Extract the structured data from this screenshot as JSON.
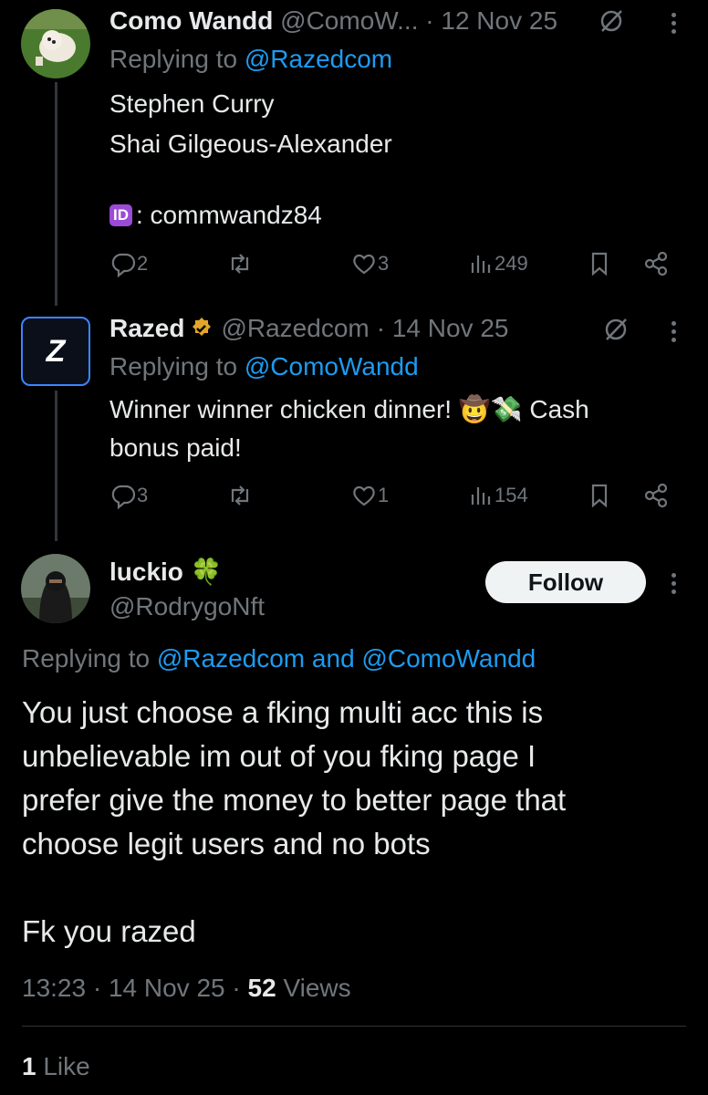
{
  "tweet1": {
    "name": "Como Wandd",
    "handle": "@ComoW...",
    "date": "· 12 Nov 25",
    "replying_prefix": "Replying to ",
    "replying_to": "@Razedcom",
    "lines": [
      "Stephen Curry",
      "Shai Gilgeous-Alexander"
    ],
    "id_badge": "ID",
    "id_text": ": commwandz84",
    "replies": "2",
    "likes": "3",
    "views": "249"
  },
  "tweet2": {
    "name": "Razed",
    "handle": "@Razedcom",
    "date": "· 14 Nov 25",
    "replying_prefix": "Replying to ",
    "replying_to": "@ComoWandd",
    "line1": "Winner winner chicken dinner!",
    "line1_emoji": "🤠💸",
    "line1_end": "Cash",
    "line2": "bonus paid!",
    "replies": "3",
    "likes": "1",
    "views": "154",
    "logo_letter": "Z"
  },
  "main": {
    "name": "luckio",
    "name_emoji": "🍀",
    "handle": "@RodrygoNft",
    "follow_label": "Follow",
    "replying_prefix": "Replying to ",
    "replying_to_1": "@Razedcom",
    "replying_and": " and ",
    "replying_to_2": "@ComoWandd",
    "body_lines": [
      "You just choose a fking multi acc this is",
      "unbelievable im out of you fking page I",
      "prefer give the money to better page that",
      "choose legit users and no bots"
    ],
    "body_last": "Fk you razed",
    "time": "13:23",
    "date": "· 14 Nov 25 ·",
    "views_count": "52",
    "views_label": "Views",
    "likes_count": "1",
    "likes_label": "Like"
  },
  "colors": {
    "accent": "#1d9bf0",
    "verified": "#e2a52a",
    "muted": "#71767b"
  },
  "icons": [
    "reply-icon",
    "retweet-icon",
    "like-icon",
    "views-icon",
    "bookmark-icon",
    "share-icon",
    "grok-icon",
    "more-icon",
    "verified-icon"
  ]
}
